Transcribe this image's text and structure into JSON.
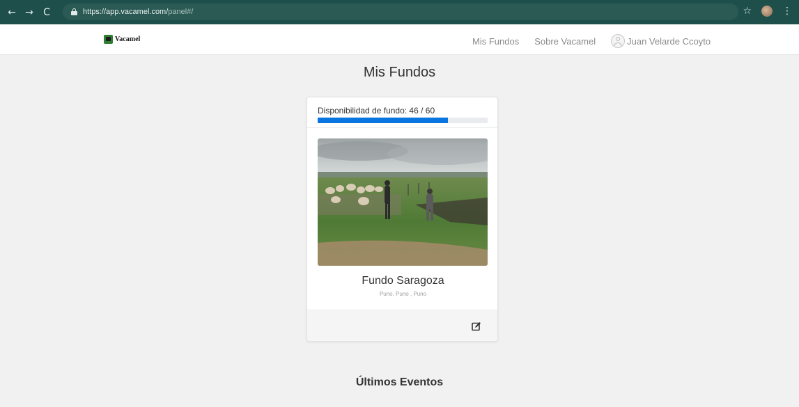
{
  "browser": {
    "url_host": "https://app.vacamel.com/",
    "url_path": "panel#/",
    "back_icon": "arrow-left",
    "forward_icon": "arrow-right",
    "reload_icon": "reload",
    "bookmark_icon": "star",
    "menu_icon": "vertical-dots"
  },
  "navbar": {
    "brand": "Vacamel",
    "links": [
      "Mis Fundos",
      "Sobre Vacamel"
    ],
    "user_name": "Juan Velarde Ccoyto"
  },
  "main": {
    "title": "Mis Fundos",
    "card": {
      "availability_label": "Disponibilidad de fundo: 46 / 60",
      "availability_used": 46,
      "availability_total": 60,
      "progress_color": "#0a74e0",
      "name": "Fundo Saragoza",
      "location": "Puno, Puno , Puno",
      "edit_icon": "edit-square"
    },
    "events_title": "Últimos Eventos"
  },
  "colors": {
    "browser_chrome": "#1e4f4a",
    "page_bg": "#f1f1f1"
  }
}
